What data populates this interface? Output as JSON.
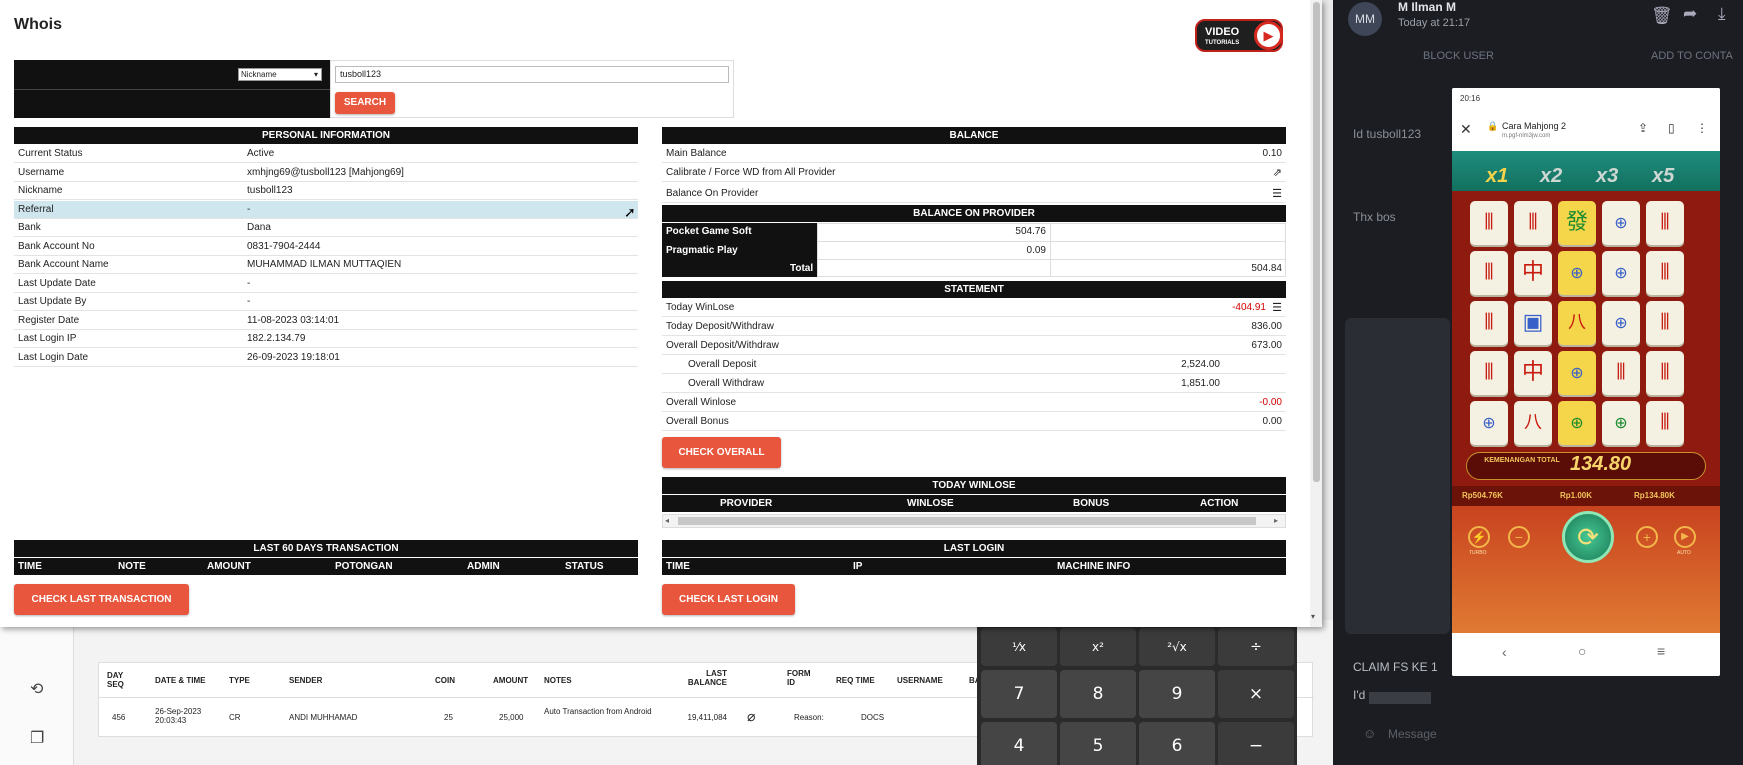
{
  "modal": {
    "title": "Whois",
    "video_badge": {
      "top": "VIDEO",
      "bottom": "TUTORIALS"
    },
    "search": {
      "select_value": "Nickname",
      "input_value": "tusboll123",
      "button": "SEARCH"
    },
    "personal": {
      "header": "PERSONAL INFORMATION",
      "rows": [
        {
          "k": "Current Status",
          "v": "Active"
        },
        {
          "k": "Username",
          "v": "xmhjng69@tusboll123  [Mahjong69]"
        },
        {
          "k": "Nickname",
          "v": "tusboll123"
        },
        {
          "k": "Referral",
          "v": "-"
        },
        {
          "k": "Bank",
          "v": "Dana"
        },
        {
          "k": "Bank Account No",
          "v": "0831-7904-2444"
        },
        {
          "k": "Bank Account Name",
          "v": "MUHAMMAD ILMAN MUTTAQIEN"
        },
        {
          "k": "Last Update Date",
          "v": "-"
        },
        {
          "k": "Last Update By",
          "v": "-"
        },
        {
          "k": "Register Date",
          "v": "11-08-2023 03:14:01"
        },
        {
          "k": "Last Login IP",
          "v": "182.2.134.79"
        },
        {
          "k": "Last Login Date",
          "v": "26-09-2023 19:18:01"
        }
      ]
    },
    "balance": {
      "header": "BALANCE",
      "main_label": "Main Balance",
      "main_value": "0.10",
      "calibrate_label": "Calibrate / Force WD from All Provider",
      "provider_label": "Balance On Provider"
    },
    "balance_provider": {
      "header": "BALANCE ON PROVIDER",
      "rows": [
        {
          "name": "Pocket Game Soft",
          "value": "504.76"
        },
        {
          "name": "Pragmatic Play",
          "value": "0.09"
        }
      ],
      "total_label": "Total",
      "total_value": "504.84"
    },
    "statement": {
      "header": "STATEMENT",
      "rows": [
        {
          "k": "Today WinLose",
          "v": "-404.91"
        },
        {
          "k": "Today Deposit/Withdraw",
          "v": "836.00"
        },
        {
          "k": "Overall Deposit/Withdraw",
          "v": "673.00"
        },
        {
          "k": "Overall Deposit",
          "v": "2,524.00"
        },
        {
          "k": "Overall Withdraw",
          "v": "1,851.00"
        },
        {
          "k": "Overall Winlose",
          "v": "-0.00"
        },
        {
          "k": "Overall Bonus",
          "v": "0.00"
        }
      ],
      "button": "CHECK OVERALL"
    },
    "today_winlose": {
      "header": "TODAY WINLOSE",
      "cols": [
        "PROVIDER",
        "WINLOSE",
        "BONUS",
        "ACTION"
      ]
    },
    "last60": {
      "header": "LAST 60 DAYS TRANSACTION",
      "cols": [
        "TIME",
        "NOTE",
        "AMOUNT",
        "POTONGAN",
        "ADMIN",
        "STATUS"
      ],
      "button": "CHECK LAST TRANSACTION"
    },
    "last_login": {
      "header": "LAST LOGIN",
      "cols": [
        "TIME",
        "IP",
        "MACHINE INFO"
      ],
      "button": "CHECK LAST LOGIN"
    }
  },
  "bg_table": {
    "cols": [
      "DAY SEQ",
      "DATE & TIME",
      "TYPE",
      "SENDER",
      "COIN",
      "AMOUNT",
      "NOTES",
      "LAST BALANCE",
      "FORM ID",
      "REQ TIME",
      "USERNAME",
      "BA"
    ],
    "row": [
      "456",
      "26-Sep-2023 20:03:43",
      "CR",
      "ANDI MUHHAMAD",
      "25",
      "25,000",
      "Auto Transaction from Android",
      "19,411,084",
      "",
      "Reason:",
      "DOCS"
    ]
  },
  "calculator": {
    "row1": [
      "¹⁄x",
      "x²",
      "²√x",
      "÷"
    ],
    "row2": [
      "7",
      "8",
      "9",
      "×"
    ],
    "row3": [
      "4",
      "5",
      "6",
      "−"
    ]
  },
  "chat": {
    "avatar": "MM",
    "name": "M Ilman M",
    "time": "Today at 21:17",
    "block_user": "BLOCK USER",
    "add_contact": "ADD TO CONTA",
    "msg1": "Id tusboll123",
    "msg2": "Thx bos",
    "msg3": "CLAIM FS KE 1",
    "msg4": "I'd",
    "input_placeholder": "Message"
  },
  "phone": {
    "status_time": "20:16",
    "url_title": "Cara Mahjong 2",
    "url": "m.pgf-nlm3jw.com",
    "multipliers": [
      "x1",
      "x2",
      "x3",
      "x5"
    ],
    "win_label": "KEMENANGAN TOTAL",
    "win_value": "134.80",
    "stats": [
      "Rp504.76K",
      "Rp1.00K",
      "Rp134.80K"
    ],
    "btn_turbo": "TURBO",
    "btn_auto": "AUTO"
  },
  "colors": {
    "accent": "#e8573d",
    "header_bg": "#111111",
    "highlight": "#cfe6ee",
    "red_value": "#d40000"
  }
}
